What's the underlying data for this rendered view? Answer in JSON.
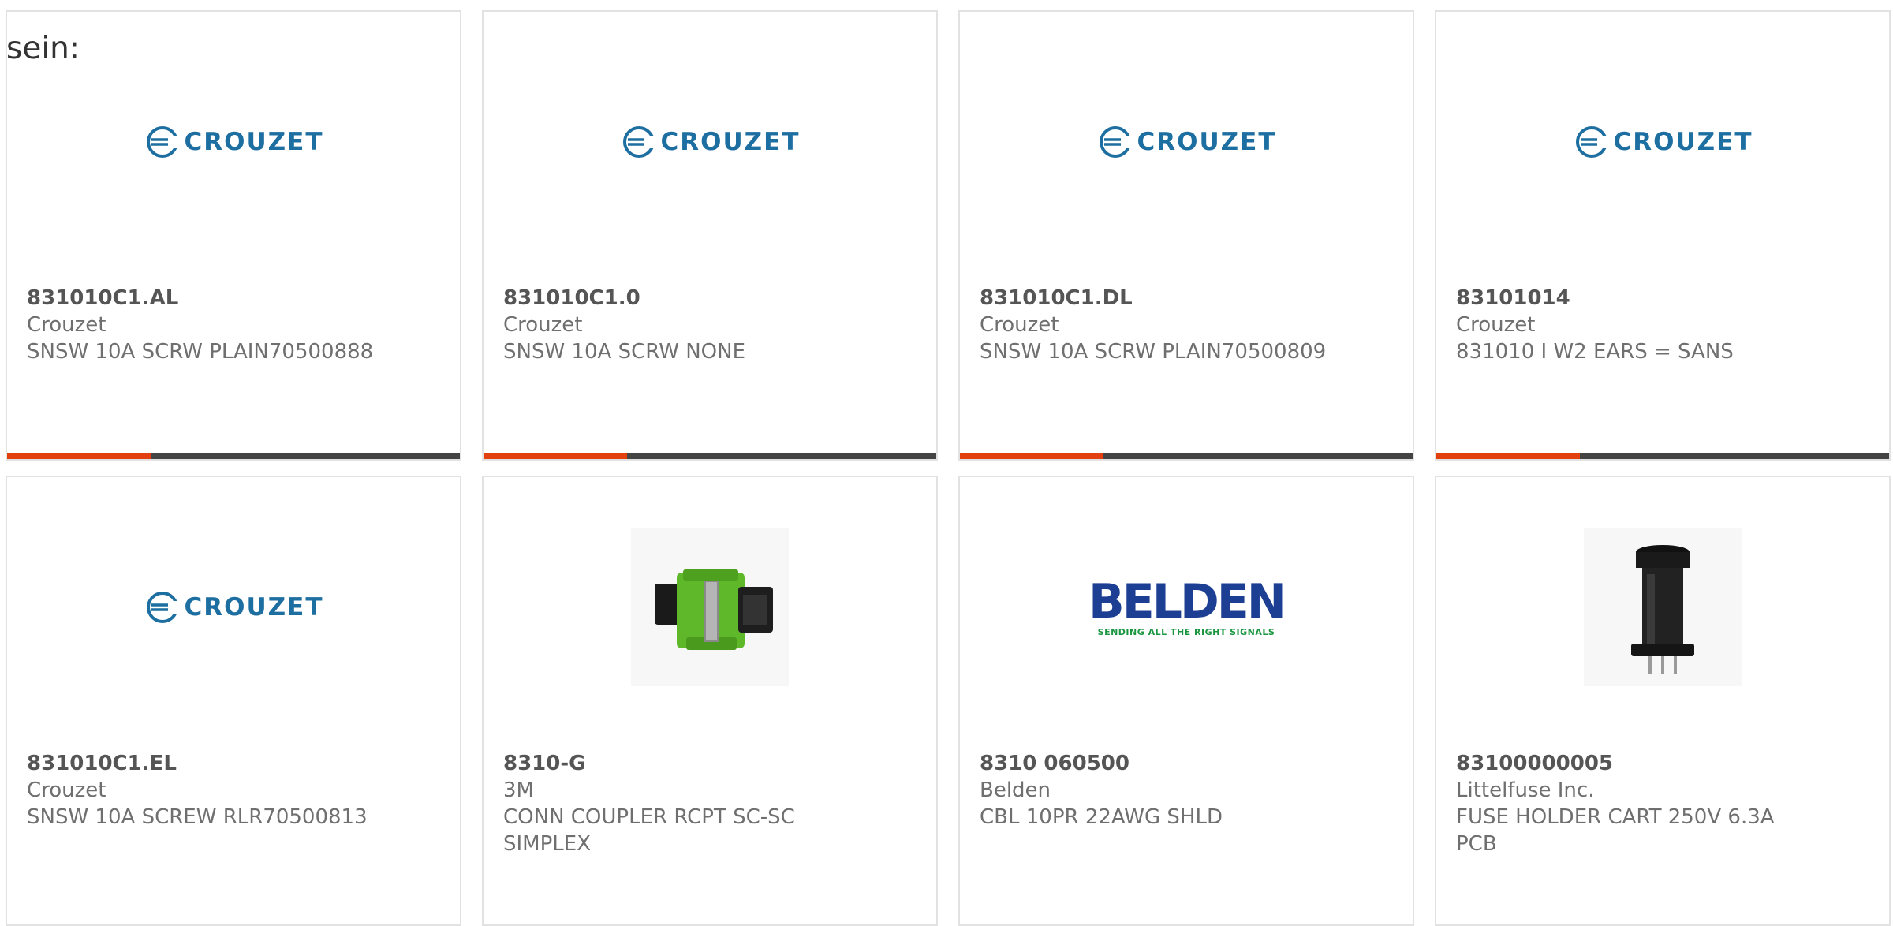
{
  "intro_text": "sein:",
  "colors": {
    "accent": "#e2410f",
    "bar": "#444444",
    "crouzet_blue": "#1d6ea1",
    "belden_blue": "#1c3f94",
    "belden_green": "#1a9640"
  },
  "products": [
    {
      "part_number": "831010C1.AL",
      "manufacturer": "Crouzet",
      "description": "SNSW 10A SCRW PLAIN70500888",
      "image": "crouzet-logo",
      "logo_text": "CROUZET"
    },
    {
      "part_number": "831010C1.0",
      "manufacturer": "Crouzet",
      "description": "SNSW 10A SCRW NONE",
      "image": "crouzet-logo",
      "logo_text": "CROUZET"
    },
    {
      "part_number": "831010C1.DL",
      "manufacturer": "Crouzet",
      "description": "SNSW 10A SCRW PLAIN70500809",
      "image": "crouzet-logo",
      "logo_text": "CROUZET"
    },
    {
      "part_number": "83101014",
      "manufacturer": "Crouzet",
      "description": "831010 I W2 EARS = SANS",
      "image": "crouzet-logo",
      "logo_text": "CROUZET"
    },
    {
      "part_number": "831010C1.EL",
      "manufacturer": "Crouzet",
      "description": "SNSW 10A SCREW RLR70500813",
      "image": "crouzet-logo",
      "logo_text": "CROUZET"
    },
    {
      "part_number": "8310-G",
      "manufacturer": "3M",
      "description": "CONN COUPLER RCPT SC-SC\nSIMPLEX",
      "image": "fiber-coupler-photo"
    },
    {
      "part_number": "8310 060500",
      "manufacturer": "Belden",
      "description": "CBL 10PR 22AWG SHLD",
      "image": "belden-logo",
      "logo_text": "BELDEN",
      "logo_tagline": "SENDING ALL THE RIGHT SIGNALS"
    },
    {
      "part_number": "83100000005",
      "manufacturer": "Littelfuse Inc.",
      "description": "FUSE HOLDER CART 250V 6.3A\nPCB",
      "image": "fuse-holder-photo"
    }
  ]
}
